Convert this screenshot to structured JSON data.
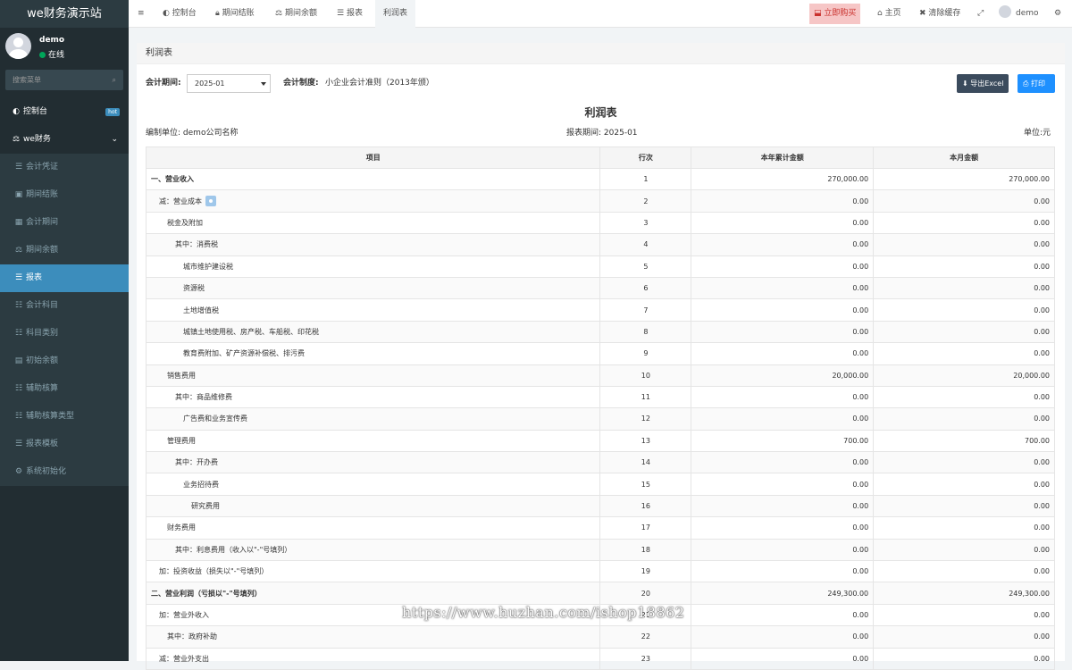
{
  "app": {
    "logo": "we财务演示站"
  },
  "user": {
    "name": "demo",
    "status": "在线"
  },
  "sidebar": {
    "search_placeholder": "搜索菜单",
    "dashboard": {
      "label": "控制台",
      "badge": "hot"
    },
    "group": {
      "label": "we财务"
    },
    "items": [
      {
        "label": "会计凭证",
        "icon": "file-icon"
      },
      {
        "label": "期间结账",
        "icon": "lock-icon"
      },
      {
        "label": "会计期间",
        "icon": "calendar-icon"
      },
      {
        "label": "期间余额",
        "icon": "balance-icon"
      },
      {
        "label": "报表",
        "icon": "file-icon",
        "active": true
      },
      {
        "label": "会计科目",
        "icon": "list-icon"
      },
      {
        "label": "科目类别",
        "icon": "list-icon"
      },
      {
        "label": "初始余额",
        "icon": "money-icon"
      },
      {
        "label": "辅助核算",
        "icon": "list-icon"
      },
      {
        "label": "辅助核算类型",
        "icon": "list-icon"
      },
      {
        "label": "报表模板",
        "icon": "file-icon"
      },
      {
        "label": "系统初始化",
        "icon": "gear-icon"
      }
    ]
  },
  "topbar": {
    "tabs": [
      "控制台",
      "期间结账",
      "期间余额",
      "报表",
      "利润表"
    ],
    "buy": "立即购买",
    "home": "主页",
    "clear_cache": "清除缓存",
    "user": "demo"
  },
  "panel": {
    "title": "利润表"
  },
  "filters": {
    "period_label": "会计期间:",
    "period_value": "2025-01",
    "system_label": "会计制度:",
    "system_value": "小企业会计准则（2013年颁）"
  },
  "actions": {
    "export": "导出Excel",
    "print": "打印"
  },
  "report": {
    "title": "利润表",
    "unit_label": "编制单位:",
    "unit_value": "demo公司名称",
    "period_label": "报表期间:",
    "period_value": "2025-01",
    "currency_label": "单位:",
    "currency_value": "元"
  },
  "table": {
    "headers": [
      "项目",
      "行次",
      "本年累计金额",
      "本月金额"
    ],
    "rows": [
      {
        "item": "一、营业收入",
        "indent": 0,
        "bold": true,
        "line": "1",
        "ytd": "270,000.00",
        "month": "270,000.00"
      },
      {
        "item": "减：营业成本",
        "indent": 1,
        "line": "2",
        "ytd": "0.00",
        "month": "0.00",
        "badge": true
      },
      {
        "item": "税金及附加",
        "indent": 2,
        "line": "3",
        "ytd": "0.00",
        "month": "0.00"
      },
      {
        "item": "其中：消费税",
        "indent": 3,
        "line": "4",
        "ytd": "0.00",
        "month": "0.00"
      },
      {
        "item": "城市维护建设税",
        "indent": 4,
        "line": "5",
        "ytd": "0.00",
        "month": "0.00"
      },
      {
        "item": "资源税",
        "indent": 4,
        "line": "6",
        "ytd": "0.00",
        "month": "0.00"
      },
      {
        "item": "土地增值税",
        "indent": 4,
        "line": "7",
        "ytd": "0.00",
        "month": "0.00"
      },
      {
        "item": "城镇土地使用税、房产税、车船税、印花税",
        "indent": 4,
        "line": "8",
        "ytd": "0.00",
        "month": "0.00"
      },
      {
        "item": "教育费附加、矿产资源补偿税、排污费",
        "indent": 4,
        "line": "9",
        "ytd": "0.00",
        "month": "0.00"
      },
      {
        "item": "销售费用",
        "indent": 2,
        "line": "10",
        "ytd": "20,000.00",
        "month": "20,000.00"
      },
      {
        "item": "其中：商品维修费",
        "indent": 3,
        "line": "11",
        "ytd": "0.00",
        "month": "0.00"
      },
      {
        "item": "广告费和业务宣传费",
        "indent": 4,
        "line": "12",
        "ytd": "0.00",
        "month": "0.00"
      },
      {
        "item": "管理费用",
        "indent": 2,
        "line": "13",
        "ytd": "700.00",
        "month": "700.00"
      },
      {
        "item": "其中：开办费",
        "indent": 3,
        "line": "14",
        "ytd": "0.00",
        "month": "0.00"
      },
      {
        "item": "业务招待费",
        "indent": 4,
        "line": "15",
        "ytd": "0.00",
        "month": "0.00"
      },
      {
        "item": "研究费用",
        "indent": 5,
        "line": "16",
        "ytd": "0.00",
        "month": "0.00"
      },
      {
        "item": "财务费用",
        "indent": 2,
        "line": "17",
        "ytd": "0.00",
        "month": "0.00"
      },
      {
        "item": "其中：利息费用（收入以\"-\"号填列）",
        "indent": 3,
        "line": "18",
        "ytd": "0.00",
        "month": "0.00"
      },
      {
        "item": "加：投资收益（损失以\"-\"号填列）",
        "indent": 1,
        "line": "19",
        "ytd": "0.00",
        "month": "0.00"
      },
      {
        "item": "二、营业利润（亏损以\"-\"号填列）",
        "indent": 0,
        "bold": true,
        "line": "20",
        "ytd": "249,300.00",
        "month": "249,300.00"
      },
      {
        "item": "加：营业外收入",
        "indent": 1,
        "line": "21",
        "ytd": "0.00",
        "month": "0.00"
      },
      {
        "item": "其中：政府补助",
        "indent": 2,
        "line": "22",
        "ytd": "0.00",
        "month": "0.00"
      },
      {
        "item": "减：营业外支出",
        "indent": 1,
        "line": "23",
        "ytd": "0.00",
        "month": "0.00"
      }
    ]
  },
  "watermark": "https://www.huzhan.com/ishop18862"
}
